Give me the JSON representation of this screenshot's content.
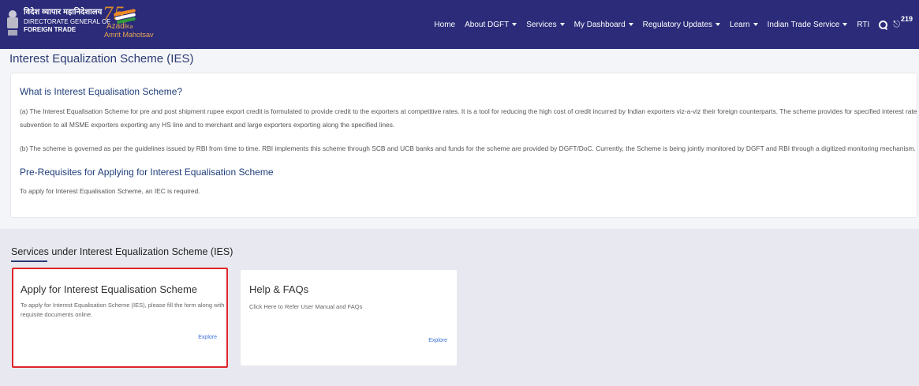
{
  "header": {
    "brand_hindi": "विदेश व्यापार महानिदेशालय",
    "brand_en_line1": "DIRECTORATE GENERAL OF",
    "brand_en_line2": "FOREIGN TRADE",
    "azadi_number": "75",
    "azadi_word": "Azadi",
    "azadi_ka": "Ka",
    "azadi_line2": "Amrit Mahotsav",
    "nav": [
      {
        "label": "Home",
        "dropdown": false
      },
      {
        "label": "About DGFT",
        "dropdown": true
      },
      {
        "label": "Services",
        "dropdown": true
      },
      {
        "label": "My Dashboard",
        "dropdown": true
      },
      {
        "label": "Regulatory Updates",
        "dropdown": true
      },
      {
        "label": "Learn",
        "dropdown": true
      },
      {
        "label": "Indian Trade Service",
        "dropdown": true
      },
      {
        "label": "RTI",
        "dropdown": false
      }
    ],
    "search_icon": "search-icon",
    "notification_icon": "bell-icon",
    "notification_count": "219"
  },
  "page": {
    "title": "Interest Equalization Scheme (IES)"
  },
  "info": {
    "heading_what": "What is Interest Equalisation Scheme?",
    "para_a": "(a) The Interest Equalisation Scheme for pre and post shipment rupee export credit is formulated to provide credit to the exporters at competitive rates. It is a tool for reducing the high cost of credit incurred by Indian exporters viz-a-viz their foreign counterparts. The scheme provides for specified interest rate subvention to all MSME exporters exporting any HS line and to merchant and large exporters exporting along the specified lines.",
    "para_b": "(b) The scheme is governed as per the guidelines issued by RBI from time to time. RBI implements this scheme through SCB and UCB banks and funds for the scheme are provided by DGFT/DoC. Currently, the Scheme is being jointly monitored by DGFT and RBI through a digitized monitoring mechanism.",
    "heading_pre": "Pre-Requisites for Applying for Interest Equalisation Scheme",
    "para_pre": "To apply for Interest Equalisation Scheme, an IEC is required."
  },
  "services": {
    "title": "Services under Interest Equalization Scheme (IES)",
    "cards": [
      {
        "title": "Apply for Interest Equalisation Scheme",
        "description": "To apply for Interest Equalisation Scheme (IES), please fill the form along with requisite documents online.",
        "link": "Explore",
        "highlighted": true,
        "highlight_color": "#e0242a"
      },
      {
        "title": "Help & FAQs",
        "description": "Click Here to Refer User Manual and FAQs",
        "link": "Explore",
        "highlighted": false
      }
    ]
  },
  "colors": {
    "navbar": "#2b2b7a",
    "heading": "#1f3d7a",
    "link": "#3a6fd8",
    "section_bg": "#e8e9f0"
  }
}
